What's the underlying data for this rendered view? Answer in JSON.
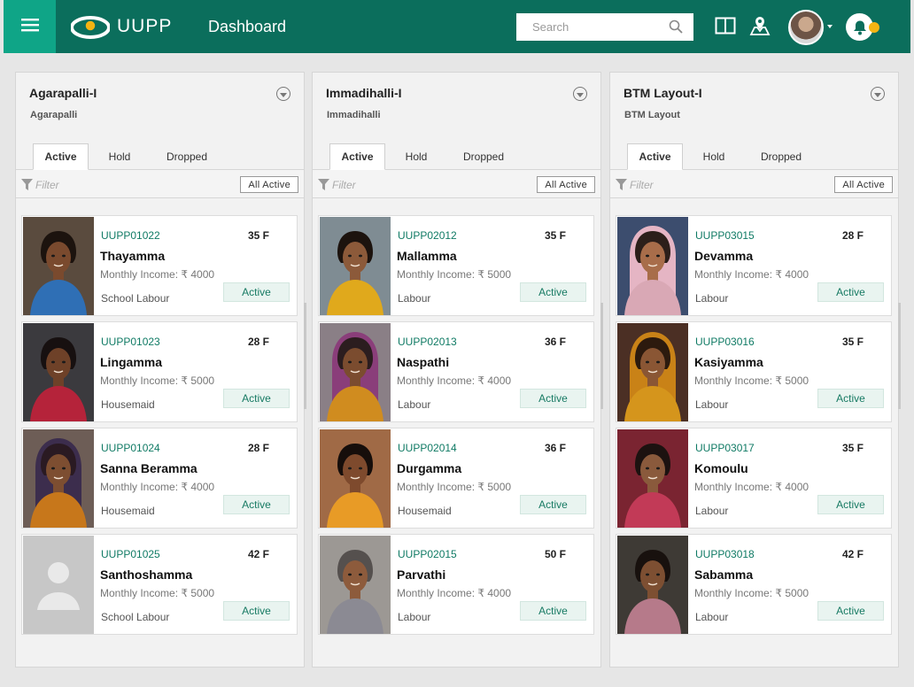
{
  "header": {
    "brand": "UUPP",
    "title": "Dashboard",
    "search_placeholder": "Search"
  },
  "colors": {
    "topbar": "#0b6e5c",
    "menu": "#0fa587",
    "id_text": "#0f7a64",
    "notify_dot": "#f4b412"
  },
  "columns": [
    {
      "title": "Agarapalli-I",
      "subtitle": "Agarapalli",
      "tabs": [
        "Active",
        "Hold",
        "Dropped"
      ],
      "filter_placeholder": "Filter",
      "filter_button": "All Active",
      "cards": [
        {
          "id": "UUPP01022",
          "age": "35 F",
          "name": "Thayamma",
          "income": "Monthly Income: ₹ 4000",
          "job": "School Labour",
          "status": "Active",
          "photo": "portrait-blue"
        },
        {
          "id": "UUPP01023",
          "age": "28 F",
          "name": "Lingamma",
          "income": "Monthly Income: ₹ 5000",
          "job": "Housemaid",
          "status": "Active",
          "photo": "portrait-red"
        },
        {
          "id": "UUPP01024",
          "age": "28 F",
          "name": "Sanna Beramma",
          "income": "Monthly Income: ₹ 4000",
          "job": "Housemaid",
          "status": "Active",
          "photo": "portrait-scarf"
        },
        {
          "id": "UUPP01025",
          "age": "42 F",
          "name": "Santhoshamma",
          "income": "Monthly Income: ₹ 5000",
          "job": "School Labour",
          "status": "Active",
          "photo": "placeholder"
        }
      ]
    },
    {
      "title": "Immadihalli-I",
      "subtitle": "Immadihalli",
      "tabs": [
        "Active",
        "Hold",
        "Dropped"
      ],
      "filter_placeholder": "Filter",
      "filter_button": "All Active",
      "cards": [
        {
          "id": "UUPP02012",
          "age": "35 F",
          "name": "Mallamma",
          "income": "Monthly Income: ₹ 5000",
          "job": "Labour",
          "status": "Active",
          "photo": "portrait-yellow"
        },
        {
          "id": "UUPP02013",
          "age": "36 F",
          "name": "Naspathi",
          "income": "Monthly Income: ₹ 4000",
          "job": "Labour",
          "status": "Active",
          "photo": "portrait-purple"
        },
        {
          "id": "UUPP02014",
          "age": "36 F",
          "name": "Durgamma",
          "income": "Monthly Income: ₹ 5000",
          "job": "Housemaid",
          "status": "Active",
          "photo": "portrait-orange"
        },
        {
          "id": "UUPP02015",
          "age": "50 F",
          "name": "Parvathi",
          "income": "Monthly Income: ₹ 4000",
          "job": "Labour",
          "status": "Active",
          "photo": "portrait-grey"
        }
      ]
    },
    {
      "title": "BTM Layout-I",
      "subtitle": "BTM Layout",
      "tabs": [
        "Active",
        "Hold",
        "Dropped"
      ],
      "filter_placeholder": "Filter",
      "filter_button": "All Active",
      "cards": [
        {
          "id": "UUPP03015",
          "age": "28 F",
          "name": "Devamma",
          "income": "Monthly Income: ₹ 4000",
          "job": "Labour",
          "status": "Active",
          "photo": "portrait-pink"
        },
        {
          "id": "UUPP03016",
          "age": "35 F",
          "name": "Kasiyamma",
          "income": "Monthly Income: ₹ 5000",
          "job": "Labour",
          "status": "Active",
          "photo": "portrait-gold"
        },
        {
          "id": "UUPP03017",
          "age": "35 F",
          "name": "Komoulu",
          "income": "Monthly Income: ₹ 4000",
          "job": "Labour",
          "status": "Active",
          "photo": "portrait-child"
        },
        {
          "id": "UUPP03018",
          "age": "42 F",
          "name": "Sabamma",
          "income": "Monthly Income: ₹ 5000",
          "job": "Labour",
          "status": "Active",
          "photo": "portrait-mother"
        }
      ]
    }
  ]
}
